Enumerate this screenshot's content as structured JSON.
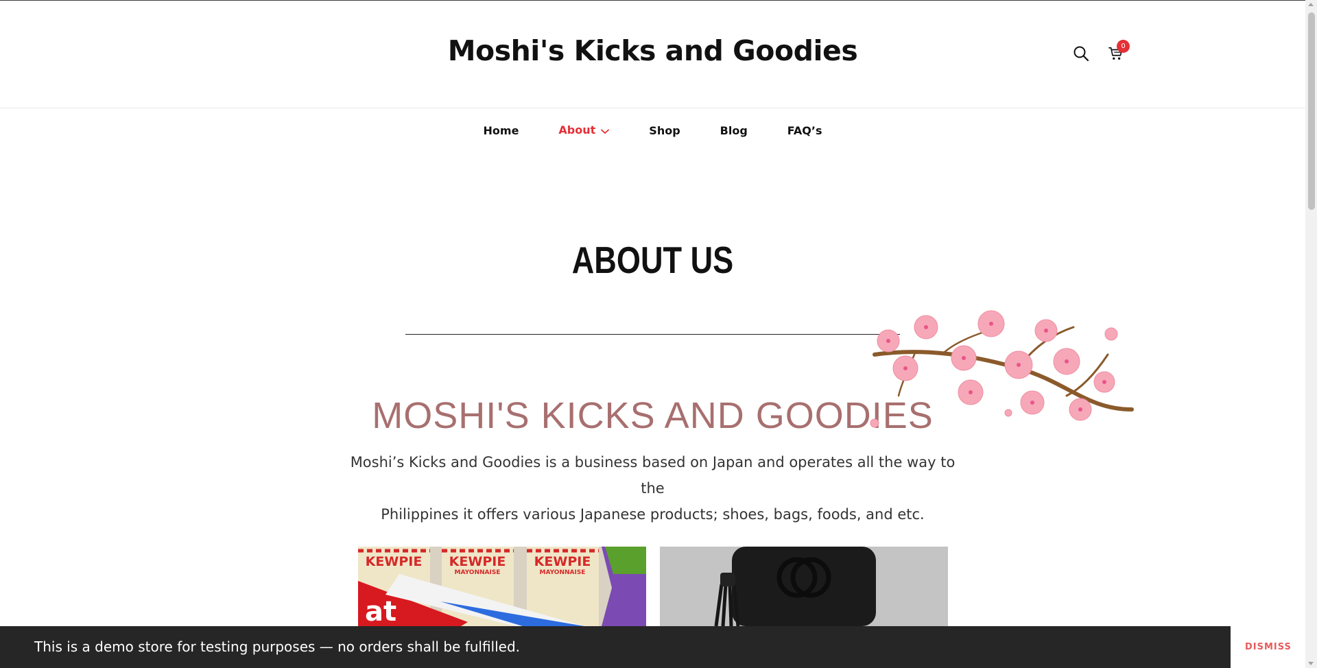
{
  "header": {
    "site_title": "Moshi's Kicks and Goodies",
    "cart_count": "0",
    "icons": [
      "search-icon",
      "cart-icon"
    ]
  },
  "nav": {
    "items": [
      {
        "label": "Home"
      },
      {
        "label": "About",
        "active": true,
        "has_dropdown": true
      },
      {
        "label": "Shop"
      },
      {
        "label": "Blog"
      },
      {
        "label": "FAQ’s"
      }
    ]
  },
  "page": {
    "heading": "ABOUT US",
    "section_title": "MOSHI'S KICKS AND GOODIES",
    "section_desc_line1": "Moshi’s Kicks and Goodies is a business based on Japan and operates all the way to the",
    "section_desc_line2": "Philippines it offers various Japanese products; shoes, bags, foods, and etc.",
    "product_images": [
      {
        "name": "Japanese foods",
        "labels": [
          "KEWPIE",
          "KEWPIE",
          "KEWPIE",
          "MAYONNAISE",
          "MAYONNAISE"
        ]
      },
      {
        "name": "Black leather bag"
      }
    ]
  },
  "notice": {
    "text": "This is a demo store for testing purposes — no orders shall be fulfilled.",
    "dismiss_label": "DISMISS"
  },
  "colors": {
    "accent": "#e52f37",
    "section_title": "#a86f6f",
    "notice_bg": "#262626",
    "dismiss": "#e55b5b"
  }
}
